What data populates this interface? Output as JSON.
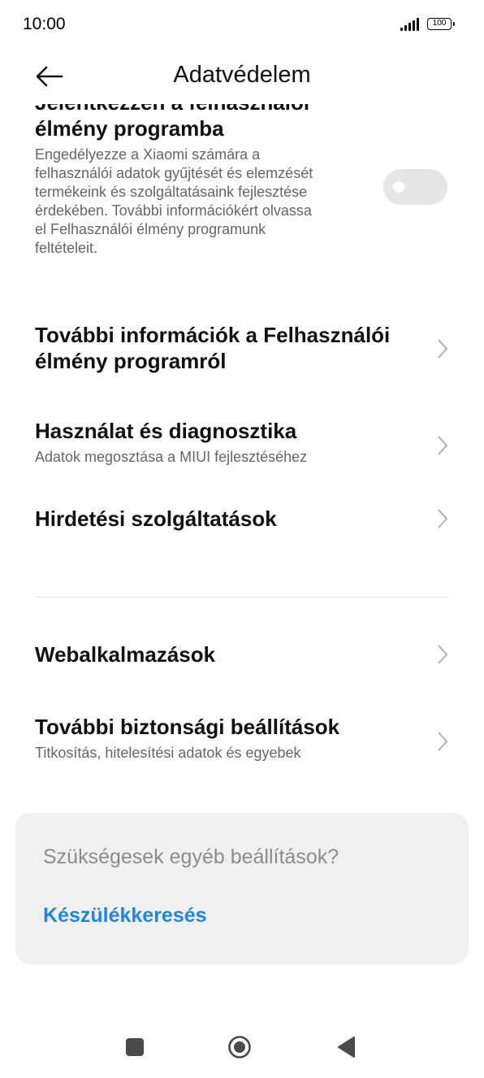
{
  "status_bar": {
    "time": "10:00",
    "battery": "100"
  },
  "header": {
    "title": "Adatvédelem"
  },
  "items": {
    "experience": {
      "title_line1": "Jelentkezzen a felhasználói",
      "title_line2": "élmény programba",
      "desc_lines": [
        "Engedélyezze a Xiaomi számára a",
        "felhasználói adatok gyűjtését és elemzését",
        "termékeink és szolgáltatásaink fejlesztése",
        "érdekében. További információkért olvassa",
        "el Felhasználói élmény programunk",
        "feltételeit."
      ],
      "toggle_on": false
    },
    "more_info": {
      "title_line1": "További információk a Felhasználói",
      "title_line2": "élmény programról"
    },
    "usage": {
      "title": "Használat és diagnosztika",
      "subtitle": "Adatok megosztása a MIUI fejlesztéséhez"
    },
    "ads": {
      "title": "Hirdetési szolgáltatások"
    },
    "webapps": {
      "title": "Webalkalmazások"
    },
    "security": {
      "title": "További biztonsági beállítások",
      "subtitle": "Titkosítás, hitelesítési adatok és egyebek"
    }
  },
  "card": {
    "question": "Szükségesek egyéb beállítások?",
    "link": "Készülékkeresés"
  },
  "colors": {
    "accent": "#1f86e8",
    "toggle_off": "#e6e6e6",
    "card_bg": "#f0f0f0"
  },
  "icons": [
    "signal-icon",
    "battery-icon",
    "back-arrow-icon",
    "chevron-right-icon",
    "nav-recents-icon",
    "nav-home-icon",
    "nav-back-icon"
  ]
}
